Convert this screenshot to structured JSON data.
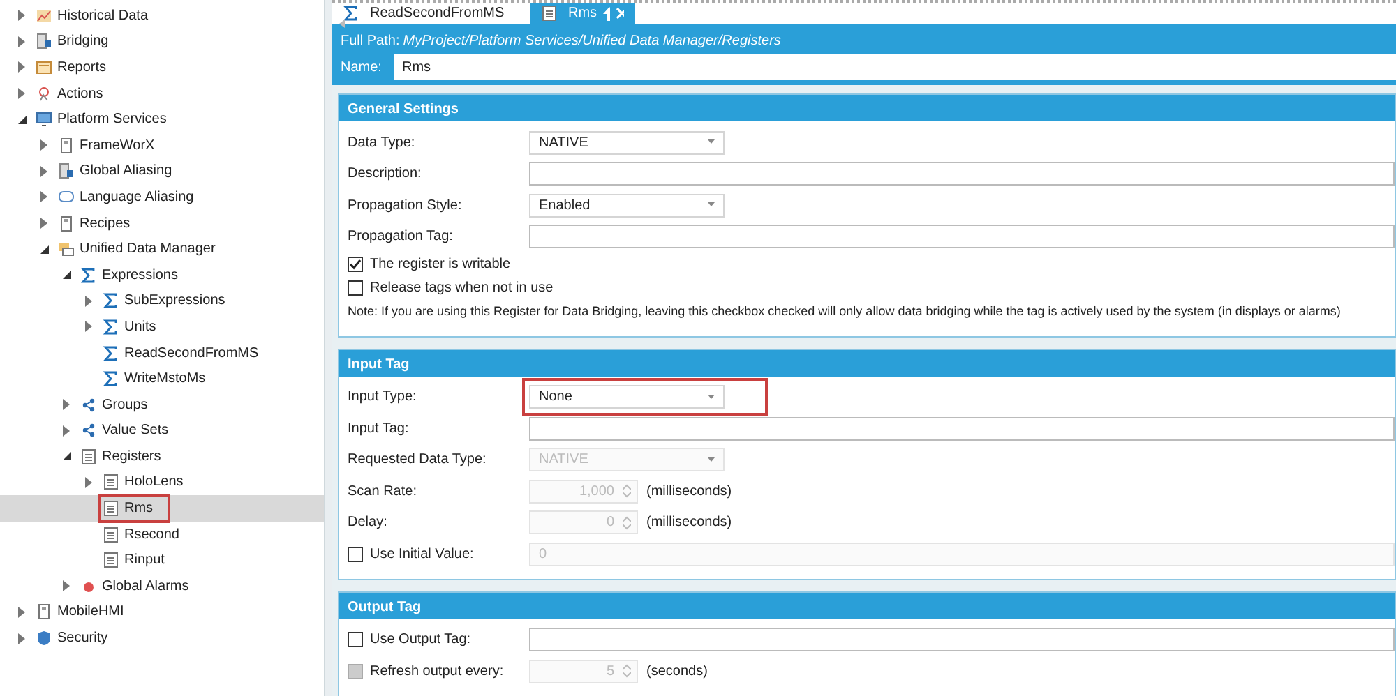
{
  "tree": [
    {
      "label": "Historical Data",
      "kind": "chart",
      "expanded": false,
      "selected": false
    },
    {
      "label": "Bridging",
      "kind": "module",
      "expanded": false,
      "selected": false
    },
    {
      "label": "Reports",
      "kind": "report",
      "expanded": false,
      "selected": false
    },
    {
      "label": "Actions",
      "kind": "action",
      "expanded": false,
      "selected": false
    },
    {
      "label": "Platform Services",
      "kind": "monitor",
      "expanded": true,
      "selected": false,
      "children": [
        {
          "label": "FrameWorX",
          "kind": "device",
          "expanded": false,
          "selected": false
        },
        {
          "label": "Global Aliasing",
          "kind": "module",
          "expanded": false,
          "selected": false
        },
        {
          "label": "Language Aliasing",
          "kind": "language",
          "expanded": false,
          "selected": false
        },
        {
          "label": "Recipes",
          "kind": "device",
          "expanded": false,
          "selected": false
        },
        {
          "label": "Unified Data Manager",
          "kind": "folder",
          "expanded": true,
          "selected": false,
          "children": [
            {
              "label": "Expressions",
              "kind": "expression",
              "expanded": true,
              "selected": false,
              "children": [
                {
                  "label": "SubExpressions",
                  "kind": "expression",
                  "expanded": false,
                  "selected": false
                },
                {
                  "label": "Units",
                  "kind": "expression",
                  "expanded": false,
                  "selected": false
                },
                {
                  "label": "ReadSecondFromMS",
                  "kind": "expression",
                  "selected": false
                },
                {
                  "label": "WriteMstoMs",
                  "kind": "expression",
                  "selected": false
                }
              ]
            },
            {
              "label": "Groups",
              "kind": "group",
              "expanded": false,
              "selected": false
            },
            {
              "label": "Value Sets",
              "kind": "group",
              "expanded": false,
              "selected": false
            },
            {
              "label": "Registers",
              "kind": "register",
              "expanded": true,
              "selected": false,
              "children": [
                {
                  "label": "HoloLens",
                  "kind": "register",
                  "expanded": false,
                  "selected": false
                },
                {
                  "label": "Rms",
                  "kind": "register",
                  "selected": true,
                  "highlighted": true
                },
                {
                  "label": "Rsecond",
                  "kind": "register",
                  "selected": false
                },
                {
                  "label": "Rinput",
                  "kind": "register",
                  "selected": false
                }
              ]
            },
            {
              "label": "Global Alarms",
              "kind": "alarm",
              "expanded": false,
              "selected": false
            }
          ]
        }
      ]
    },
    {
      "label": "MobileHMI",
      "kind": "device",
      "expanded": false,
      "selected": false
    },
    {
      "label": "Security",
      "kind": "shield",
      "expanded": false,
      "selected": false
    }
  ],
  "tabs": [
    {
      "label": "ReadSecondFromMS",
      "kind": "expression",
      "selected": false
    },
    {
      "label": "Rms",
      "kind": "register",
      "selected": true
    }
  ],
  "header": {
    "path_label": "Full Path:",
    "path": "MyProject/Platform Services/Unified Data Manager/Registers",
    "name_label": "Name:",
    "name": "Rms"
  },
  "sections": [
    {
      "title": "General Settings",
      "fields": [
        {
          "kind": "select",
          "label": "Data Type:",
          "value": "NATIVE"
        },
        {
          "kind": "text",
          "label": "Description:"
        },
        {
          "kind": "select",
          "label": "Propagation Style:",
          "value": "Enabled"
        },
        {
          "kind": "text",
          "label": "Propagation Tag:"
        },
        {
          "kind": "check",
          "label": "The register is writable",
          "checked": true
        },
        {
          "kind": "check",
          "label": "Release tags when not in use",
          "checked": false
        },
        {
          "kind": "note",
          "label": "Note: If you are using this Register for Data Bridging, leaving this checkbox checked will only allow data bridging while the tag is actively used by the system (in displays or alarms)"
        }
      ]
    },
    {
      "title": "Input Tag",
      "fields": [
        {
          "kind": "select",
          "label": "Input Type:",
          "value": "None",
          "highlighted": true
        },
        {
          "kind": "text",
          "label": "Input Tag:"
        },
        {
          "kind": "select",
          "label": "Requested Data Type:",
          "value": "NATIVE",
          "disabled": true
        },
        {
          "kind": "spin",
          "label": "Scan Rate:",
          "value": "1,000",
          "unit": "(milliseconds)",
          "disabled": true
        },
        {
          "kind": "spin",
          "label": "Delay:",
          "value": "0",
          "unit": "(milliseconds)",
          "disabled": true
        },
        {
          "kind": "checktext",
          "label": "Use Initial Value:",
          "checked": false,
          "value": "0",
          "disabled": true
        }
      ]
    },
    {
      "title": "Output Tag",
      "fields": [
        {
          "kind": "checktext",
          "label": "Use Output Tag:",
          "checked": false
        },
        {
          "kind": "checkspin",
          "label": "Refresh output every:",
          "checked": false,
          "checkdisabled": true,
          "value": "5",
          "unit": "(seconds)",
          "disabled": true
        }
      ]
    }
  ]
}
